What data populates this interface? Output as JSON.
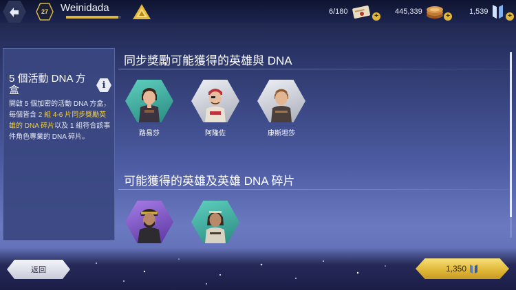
{
  "player": {
    "level": "27",
    "name": "Weinidada",
    "xp_progress": 0.95
  },
  "resources": {
    "scrolls": "6/180",
    "coins": "445,339",
    "helix": "1,539",
    "plus_label": "+"
  },
  "info_card": {
    "title": "5 個活動 DNA 方盒",
    "info_button": "i",
    "desc_part1": "開啟 5 個加密的活動 DNA 方盒，每個皆含 ",
    "desc_highlight": "2 組 4-6 片同步獎勵英雄的 DNA 碎片",
    "desc_part2": "以及 1 組符合該事件角色專業的 DNA 碎片。"
  },
  "section1": {
    "title": "同步獎勵可能獲得的英雄與 DNA",
    "heroes": [
      {
        "name": "路易莎"
      },
      {
        "name": "阿隆佐"
      },
      {
        "name": "康斯坦莎"
      }
    ]
  },
  "section2": {
    "title": "可能獲得的英雄及英雄 DNA 碎片"
  },
  "buttons": {
    "return": "返回",
    "price": "1,350"
  },
  "colors": {
    "highlight": "#f2d03b",
    "gold": "#e0b73a",
    "hex_teal": "#3aa89a",
    "hex_silver": "#c9ccd6",
    "hex_purple": "#7b4fc4"
  }
}
